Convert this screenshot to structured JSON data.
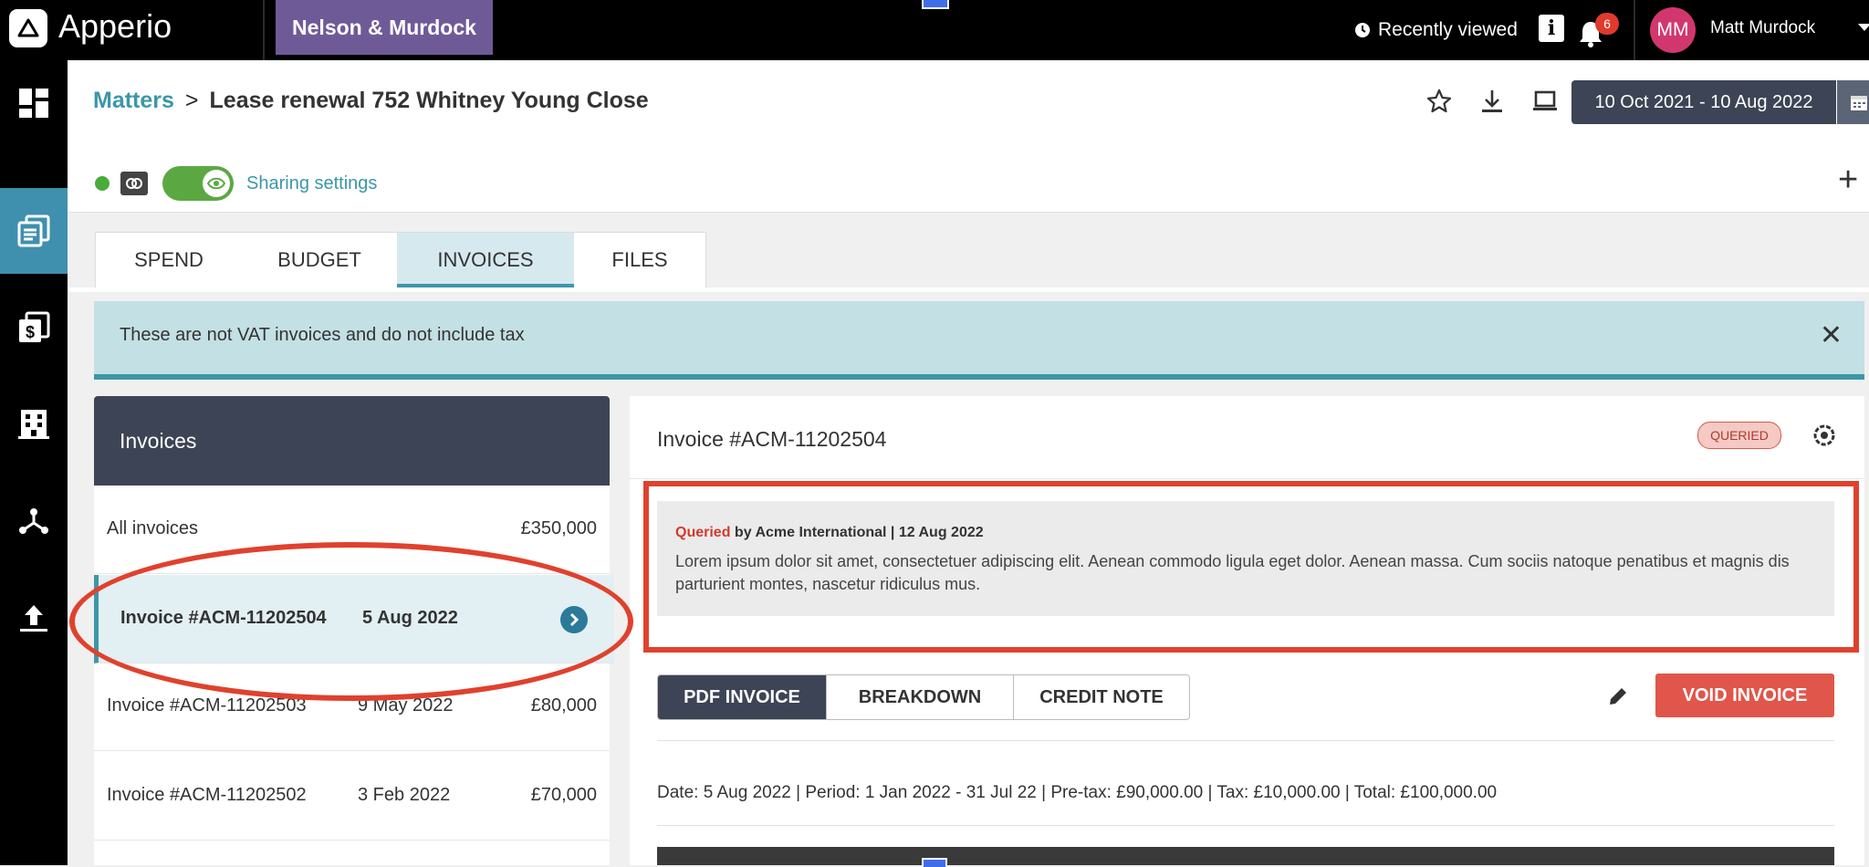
{
  "app": {
    "brand": "Apperio",
    "org": "Nelson & Murdock",
    "recently_viewed": "Recently viewed",
    "info_label": "i",
    "notifications": "6",
    "user_initials": "MM",
    "user_name": "Matt Murdock"
  },
  "breadcrumb": {
    "root": "Matters",
    "sep": ">",
    "current": "Lease renewal 752 Whitney Young Close"
  },
  "date_range": "10 Oct 2021 - 10 Aug 2022",
  "sharing_label": "Sharing settings",
  "tabs": [
    {
      "label": "SPEND",
      "active": false
    },
    {
      "label": "BUDGET",
      "active": false
    },
    {
      "label": "INVOICES",
      "active": true
    },
    {
      "label": "FILES",
      "active": false
    }
  ],
  "notice": "These are not VAT invoices and do not include tax",
  "invoices_panel": {
    "title": "Invoices",
    "all": {
      "label": "All invoices",
      "amount": "£350,000"
    },
    "rows": [
      {
        "id": "Invoice #ACM-11202504",
        "date": "5 Aug 2022",
        "amount": ""
      },
      {
        "id": "Invoice #ACM-11202503",
        "date": "9 May 2022",
        "amount": "£80,000"
      },
      {
        "id": "Invoice #ACM-11202502",
        "date": "3 Feb 2022",
        "amount": "£70,000"
      }
    ]
  },
  "detail": {
    "title": "Invoice #ACM-11202504",
    "status": "QUERIED",
    "query": {
      "status_word": "Queried",
      "by": "by Acme International | 12 Aug 2022",
      "text": "Lorem ipsum dolor sit amet, consectetuer adipiscing elit. Aenean commodo ligula eget dolor. Aenean massa. Cum sociis natoque penatibus et magnis dis parturient montes, nascetur ridiculus mus."
    },
    "view_tabs": [
      "PDF INVOICE",
      "BREAKDOWN",
      "CREDIT NOTE"
    ],
    "void_label": "VOID INVOICE",
    "summary": "Date: 5 Aug 2022 |  Period:  1 Jan 2022 - 31 Jul 22  |  Pre-tax: £90,000.00  |  Tax: £10,000.00  |  Total: £100,000.00"
  },
  "colors": {
    "accent": "#3b97a9",
    "dark": "#3d4455",
    "danger": "#e0564a",
    "org": "#6f5a98"
  }
}
